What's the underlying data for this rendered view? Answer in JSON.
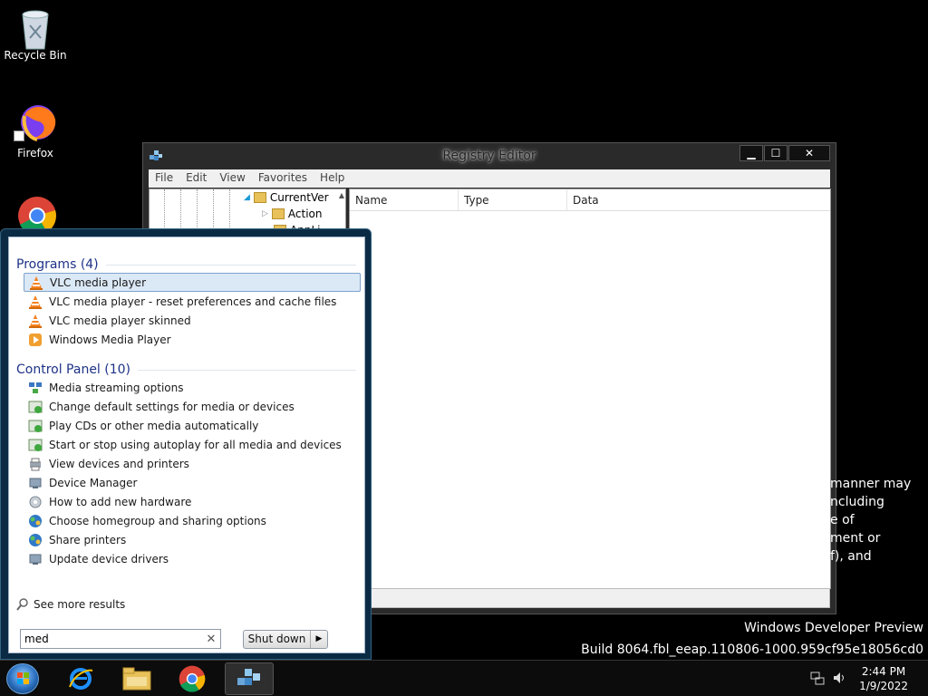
{
  "desktop": {
    "icons": [
      {
        "label": "Recycle Bin",
        "icon": "recycle-bin-icon"
      },
      {
        "label": "Firefox",
        "icon": "firefox-icon"
      },
      {
        "label": "",
        "icon": "chrome-icon"
      }
    ]
  },
  "registry_editor": {
    "title": "Registry Editor",
    "menu": [
      "File",
      "Edit",
      "View",
      "Favorites",
      "Help"
    ],
    "tree": [
      "CurrentVer",
      "Action",
      "AppLi"
    ],
    "columns": [
      "Name",
      "Type",
      "Data"
    ],
    "buttons": {
      "minimize": "▁",
      "maximize": "☐",
      "close": "✕"
    }
  },
  "start_menu": {
    "programs_header": "Programs (4)",
    "programs": [
      {
        "label": "VLC media player",
        "icon": "vlc-icon",
        "selected": true
      },
      {
        "label": "VLC media player - reset preferences and cache files",
        "icon": "vlc-icon"
      },
      {
        "label": "VLC media player skinned",
        "icon": "vlc-icon"
      },
      {
        "label": "Windows Media Player",
        "icon": "windows-media-player-icon"
      }
    ],
    "control_panel_header": "Control Panel (10)",
    "control_panel": [
      {
        "label": "Media streaming options",
        "icon": "media-streaming-icon"
      },
      {
        "label": "Change default settings for media or devices",
        "icon": "autoplay-icon"
      },
      {
        "label": "Play CDs or other media automatically",
        "icon": "autoplay-icon"
      },
      {
        "label": "Start or stop using autoplay for all media and devices",
        "icon": "autoplay-icon"
      },
      {
        "label": "View devices and printers",
        "icon": "devices-printers-icon"
      },
      {
        "label": "Device Manager",
        "icon": "device-manager-icon"
      },
      {
        "label": "How to add new hardware",
        "icon": "add-hardware-icon"
      },
      {
        "label": "Choose homegroup and sharing options",
        "icon": "homegroup-icon"
      },
      {
        "label": "Share printers",
        "icon": "homegroup-icon"
      },
      {
        "label": "Update device drivers",
        "icon": "device-manager-icon"
      }
    ],
    "see_more": "See more results",
    "search_value": "med",
    "clear": "✕",
    "shutdown": "Shut down",
    "shutdown_arrow": "▶"
  },
  "license_text": "manner may\nncluding\ne of\nment or\nf), and",
  "watermark": {
    "line1": "Windows Developer Preview",
    "line2": "Build 8064.fbl_eeap.110806-1000.959cf95e18056cd0"
  },
  "taskbar": {
    "time": "2:44 PM",
    "date": "1/9/2022",
    "pinned": [
      "internet-explorer-icon",
      "file-explorer-icon",
      "chrome-icon",
      "registry-editor-icon"
    ]
  },
  "colors": {
    "accent": "#1e3287",
    "selection": "#dbe8f6"
  }
}
